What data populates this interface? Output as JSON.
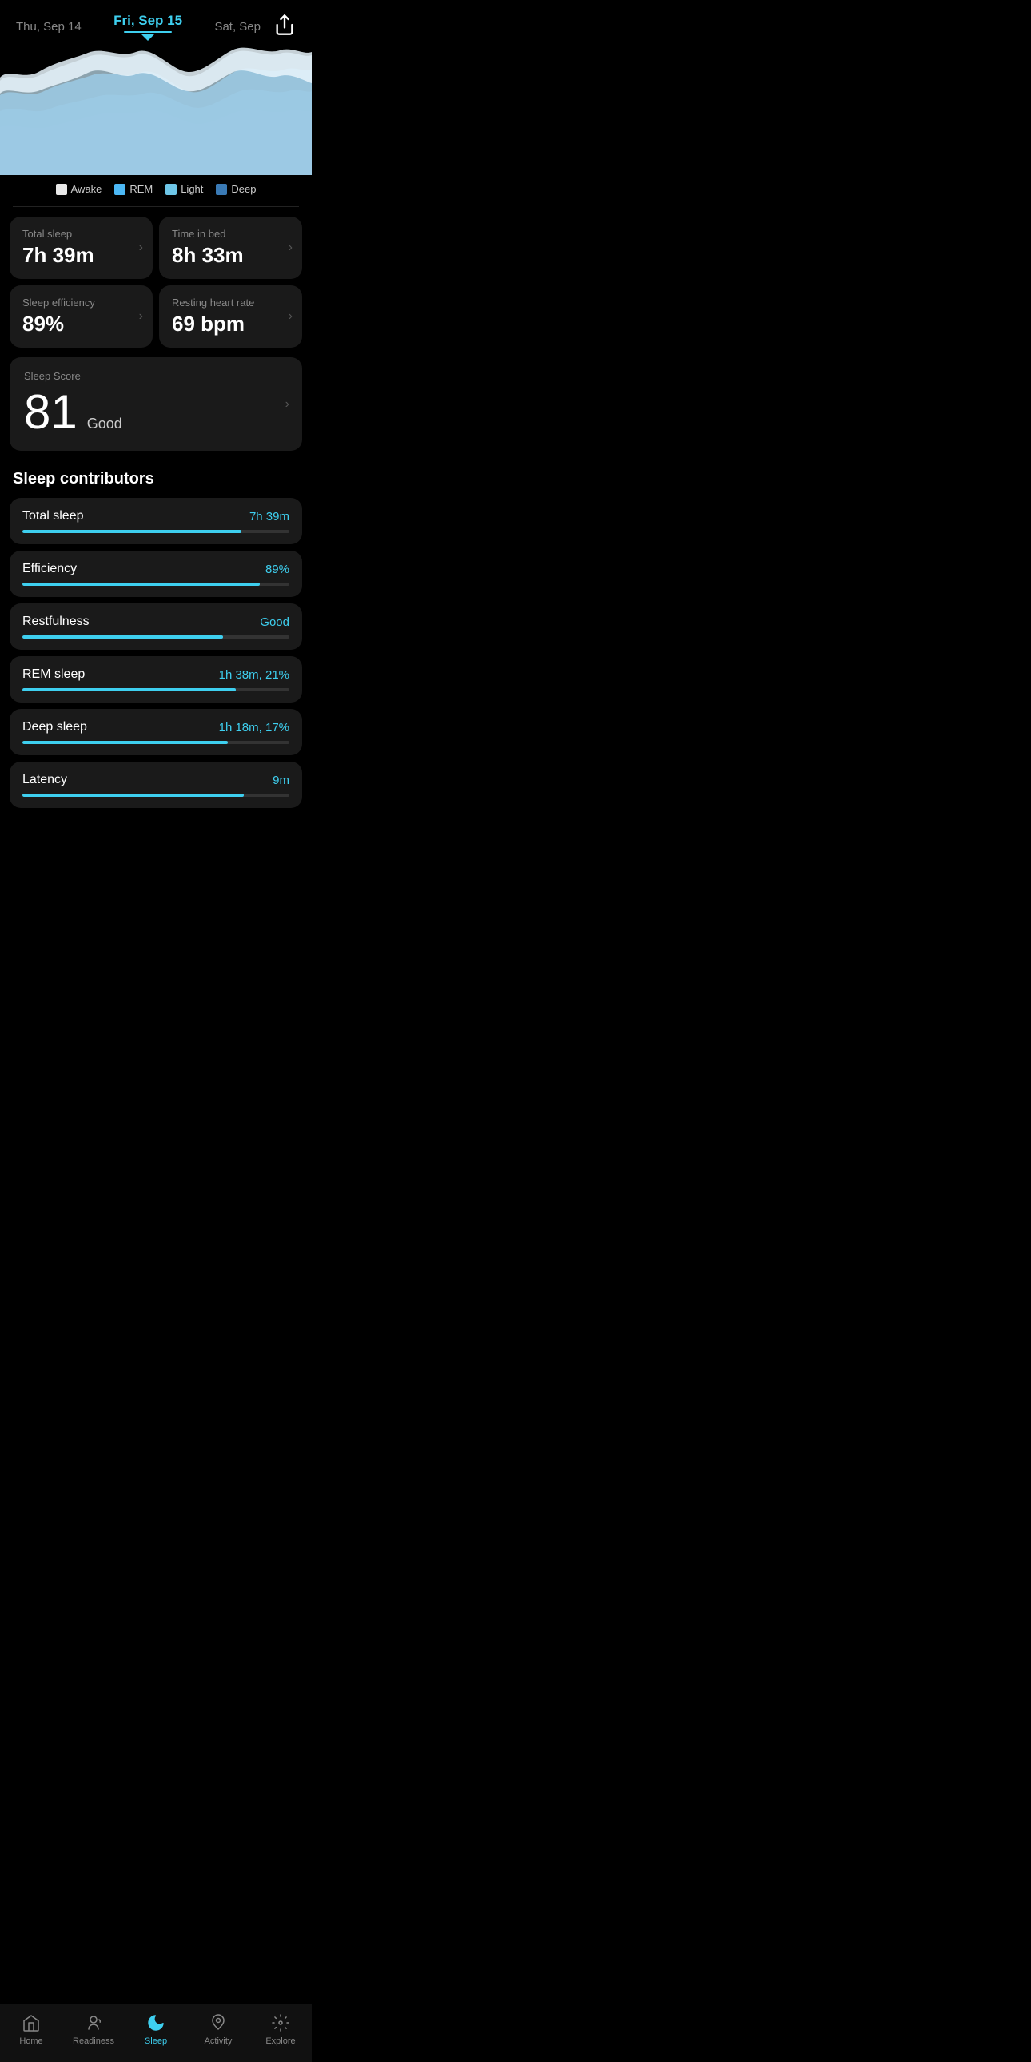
{
  "header": {
    "prev_date": "Thu, Sep 14",
    "current_date": "Fri, Sep 15",
    "next_date": "Sat, Sep"
  },
  "legend": {
    "items": [
      {
        "label": "Awake",
        "color": "#e8e8e8"
      },
      {
        "label": "REM",
        "color": "#4cb8f5"
      },
      {
        "label": "Light",
        "color": "#6ec6e8"
      },
      {
        "label": "Deep",
        "color": "#3a7ab5"
      }
    ]
  },
  "stats": [
    {
      "label": "Total sleep",
      "value": "7h 39m"
    },
    {
      "label": "Time in bed",
      "value": "8h 33m"
    },
    {
      "label": "Sleep efficiency",
      "value": "89%"
    },
    {
      "label": "Resting heart rate",
      "value": "69 bpm"
    }
  ],
  "sleep_score": {
    "label": "Sleep Score",
    "number": "81",
    "text": "Good"
  },
  "contributors": {
    "title": "Sleep contributors",
    "items": [
      {
        "name": "Total sleep",
        "value": "7h 39m",
        "fill_pct": 82
      },
      {
        "name": "Efficiency",
        "value": "89%",
        "fill_pct": 89
      },
      {
        "name": "Restfulness",
        "value": "Good",
        "fill_pct": 75
      },
      {
        "name": "REM sleep",
        "value": "1h 38m, 21%",
        "fill_pct": 80
      },
      {
        "name": "Deep sleep",
        "value": "1h 18m, 17%",
        "fill_pct": 77
      },
      {
        "name": "Latency",
        "value": "9m",
        "fill_pct": 83
      }
    ]
  },
  "bottom_nav": {
    "items": [
      {
        "label": "Home",
        "icon": "home-icon",
        "active": false
      },
      {
        "label": "Readiness",
        "icon": "readiness-icon",
        "active": false
      },
      {
        "label": "Sleep",
        "icon": "sleep-icon",
        "active": true
      },
      {
        "label": "Activity",
        "icon": "activity-icon",
        "active": false
      },
      {
        "label": "Explore",
        "icon": "explore-icon",
        "active": false
      }
    ]
  }
}
